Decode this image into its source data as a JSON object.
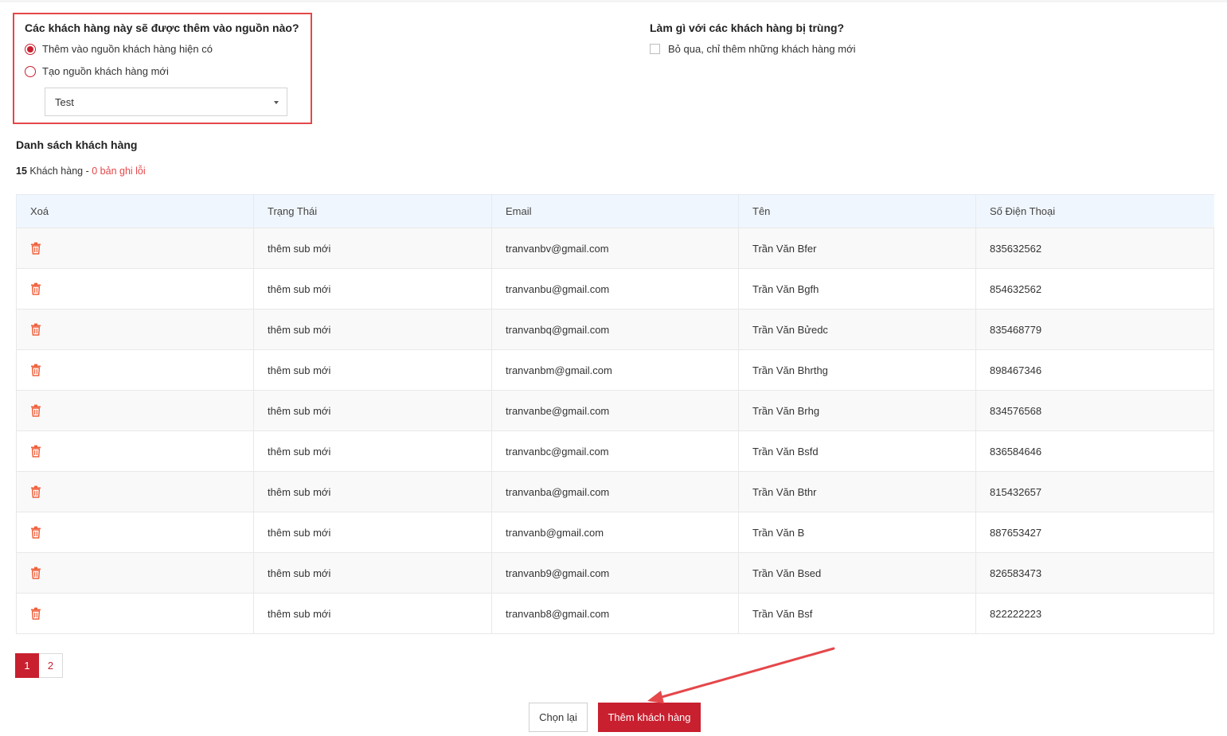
{
  "source": {
    "question": "Các khách hàng này sẽ được thêm vào nguồn nào?",
    "options": [
      {
        "label": "Thêm vào nguồn khách hàng hiện có",
        "selected": true
      },
      {
        "label": "Tạo nguồn khách hàng mới",
        "selected": false
      }
    ],
    "select_value": "Test"
  },
  "duplicates": {
    "question": "Làm gì với các khách hàng bị trùng?",
    "checkbox_label": "Bỏ qua, chỉ thêm những khách hàng mới",
    "checked": false
  },
  "list": {
    "title": "Danh sách khách hàng",
    "count": "15",
    "count_label": "Khách hàng -",
    "error_text": "0 bản ghi lỗi"
  },
  "table": {
    "headers": [
      "Xoá",
      "Trạng Thái",
      "Email",
      "Tên",
      "Số Điện Thoại"
    ],
    "rows": [
      {
        "status": "thêm sub mới",
        "email": "tranvanbv@gmail.com",
        "name": "Trần Văn Bfer",
        "phone": "835632562"
      },
      {
        "status": "thêm sub mới",
        "email": "tranvanbu@gmail.com",
        "name": "Trần Văn Bgfh",
        "phone": "854632562"
      },
      {
        "status": "thêm sub mới",
        "email": "tranvanbq@gmail.com",
        "name": "Trần Văn Bửedc",
        "phone": "835468779"
      },
      {
        "status": "thêm sub mới",
        "email": "tranvanbm@gmail.com",
        "name": "Trần Văn Bhrthg",
        "phone": "898467346"
      },
      {
        "status": "thêm sub mới",
        "email": "tranvanbe@gmail.com",
        "name": "Trần Văn Brhg",
        "phone": "834576568"
      },
      {
        "status": "thêm sub mới",
        "email": "tranvanbc@gmail.com",
        "name": "Trần Văn Bsfd",
        "phone": "836584646"
      },
      {
        "status": "thêm sub mới",
        "email": "tranvanba@gmail.com",
        "name": "Trần Văn Bthr",
        "phone": "815432657"
      },
      {
        "status": "thêm sub mới",
        "email": "tranvanb@gmail.com",
        "name": "Trần Văn B",
        "phone": "887653427"
      },
      {
        "status": "thêm sub mới",
        "email": "tranvanb9@gmail.com",
        "name": "Trần Văn Bsed",
        "phone": "826583473"
      },
      {
        "status": "thêm sub mới",
        "email": "tranvanb8@gmail.com",
        "name": "Trần Văn Bsf",
        "phone": "822222223"
      }
    ],
    "delete_icon": "trash-icon"
  },
  "pagination": {
    "pages": [
      "1",
      "2"
    ],
    "current": "1"
  },
  "actions": {
    "reset_label": "Chọn lại",
    "add_label": "Thêm khách hàng"
  },
  "colors": {
    "accent": "#c8202f",
    "status_green": "#49b25c",
    "error_red": "#e5474a",
    "header_bg": "#f0f6fd"
  }
}
